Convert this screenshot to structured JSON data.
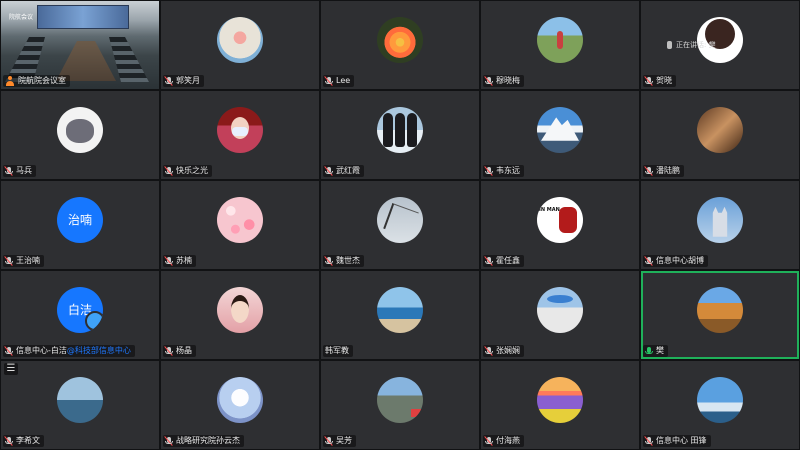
{
  "tiles": [
    {
      "name": "院航院会议室",
      "avatar": "video",
      "mic": "person",
      "video_caption": "院航会议"
    },
    {
      "name": "郭笑月",
      "avatar": "sun",
      "mic": "muted"
    },
    {
      "name": "Lee",
      "avatar": "lotus",
      "mic": "muted"
    },
    {
      "name": "穆晓梅",
      "avatar": "field",
      "mic": "muted"
    },
    {
      "name": "贺晓",
      "avatar": "dark",
      "mic": "muted",
      "speaking_label": "正在讲话: 樊"
    },
    {
      "name": "马兵",
      "avatar": "elephant",
      "mic": "muted"
    },
    {
      "name": "快乐之光",
      "avatar": "girl",
      "mic": "muted"
    },
    {
      "name": "武红霞",
      "avatar": "penguin",
      "mic": "muted"
    },
    {
      "name": "韦东远",
      "avatar": "mountain",
      "mic": "muted"
    },
    {
      "name": "潘陆鹏",
      "avatar": "cat",
      "mic": "muted"
    },
    {
      "name": "王治喃",
      "avatar": "text",
      "avatar_text": "治喃",
      "mic": "muted"
    },
    {
      "name": "苏楠",
      "avatar": "pink",
      "mic": "muted"
    },
    {
      "name": "魏世杰",
      "avatar": "tree",
      "mic": "muted"
    },
    {
      "name": "霍任鑫",
      "avatar": "ironman",
      "avatar_text": "IN MAN",
      "mic": "muted"
    },
    {
      "name": "信息中心胡博",
      "avatar": "temple",
      "mic": "muted"
    },
    {
      "name": "信息中心-白洁",
      "name_dept": "@科技部信息中心",
      "avatar": "text",
      "avatar_text": "白洁",
      "mic": "muted"
    },
    {
      "name": "杨晶",
      "avatar": "portrait",
      "mic": "muted"
    },
    {
      "name": "韩军教",
      "avatar": "sea",
      "mic": "none"
    },
    {
      "name": "张娴娴",
      "avatar": "hat",
      "mic": "muted"
    },
    {
      "name": "樊",
      "avatar": "canyon",
      "mic": "active",
      "speaking": true
    },
    {
      "name": "李希文",
      "avatar": "lake",
      "mic": "muted",
      "list_button": "☰"
    },
    {
      "name": "战略研究院孙云杰",
      "avatar": "anime",
      "mic": "muted"
    },
    {
      "name": "吴芳",
      "avatar": "city",
      "mic": "muted"
    },
    {
      "name": "付海燕",
      "avatar": "lavender",
      "mic": "muted"
    },
    {
      "name": "信息中心 田锋",
      "avatar": "clouds",
      "mic": "muted"
    }
  ],
  "colors": {
    "speaking_border": "#1fb15a",
    "accent_blue": "#1677ff"
  }
}
